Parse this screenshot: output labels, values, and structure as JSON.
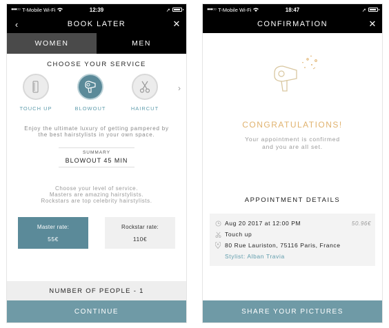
{
  "left": {
    "status": {
      "carrier": "T-Mobile Wi-Fi",
      "time": "12:39"
    },
    "nav": {
      "title": "BOOK LATER",
      "back": "‹",
      "close": "✕"
    },
    "tabs": [
      {
        "label": "WOMEN",
        "active": true
      },
      {
        "label": "MEN",
        "active": false
      }
    ],
    "section_title": "CHOOSE YOUR SERVICE",
    "services": [
      {
        "label": "TOUCH UP",
        "icon": "comb-icon"
      },
      {
        "label": "BLOWOUT",
        "icon": "hair-dryer-icon",
        "selected": true
      },
      {
        "label": "HAIRCUT",
        "icon": "scissors-icon"
      }
    ],
    "next_arrow": "›",
    "service_desc": "Enjoy the ultimate luxury of getting pampered by the best hairstylists in your own space.",
    "summary": {
      "label": "SUMMARY",
      "value": "BLOWOUT 45 MIN"
    },
    "level_desc": [
      "Choose your level of service.",
      "Masters are amazing hairstylists.",
      "Rockstars are top celebrity hairstylists."
    ],
    "rates": [
      {
        "name": "Master rate:",
        "price": "55€",
        "active": true
      },
      {
        "name": "Rockstar rate:",
        "price": "110€",
        "active": false
      }
    ],
    "people": "NUMBER OF PEOPLE - 1",
    "cta": "CONTINUE"
  },
  "right": {
    "status": {
      "carrier": "T-Mobile Wi-Fi",
      "time": "18:47"
    },
    "nav": {
      "title": "CONFIRMATION",
      "close": "✕"
    },
    "congrats": "CONGRATULATIONS!",
    "confirm_text": [
      "Your appointment is confirmed",
      "and you are all set."
    ],
    "details_title": "APPOINTMENT DETAILS",
    "details": {
      "datetime": "Aug 20 2017 at 12:00 PM",
      "price": "50.96€",
      "service": "Touch up",
      "address": "80 Rue Lauriston, 75116 Paris, France",
      "stylist": "Stylist: Alban Travia"
    },
    "cta": "SHARE YOUR PICTURES"
  },
  "colors": {
    "accent": "#5b8a99",
    "cta": "#6f9aa6",
    "gold": "#e0b26e",
    "label_teal": "#5f9cac"
  }
}
